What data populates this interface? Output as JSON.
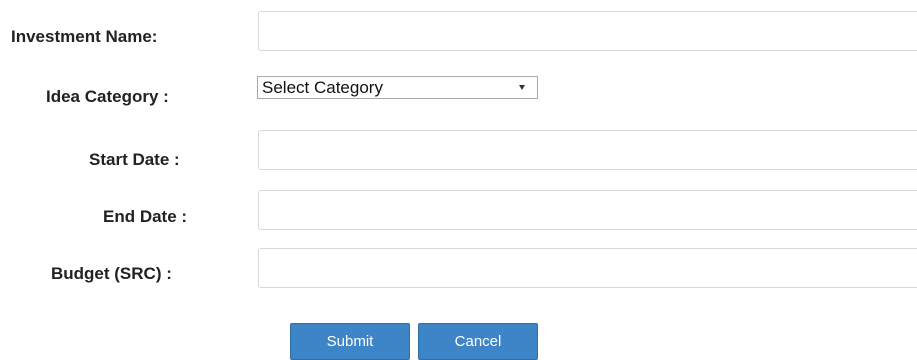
{
  "form": {
    "investment_name": {
      "label": "Investment Name:",
      "value": "",
      "placeholder": ""
    },
    "idea_category": {
      "label": "Idea Category :",
      "selected": "Select Category"
    },
    "start_date": {
      "label": "Start Date :",
      "value": "",
      "placeholder": ""
    },
    "end_date": {
      "label": "End Date :",
      "value": "",
      "placeholder": ""
    },
    "budget": {
      "label": "Budget (SRC) :",
      "value": "",
      "placeholder": ""
    },
    "submit_label": "Submit",
    "cancel_label": "Cancel"
  },
  "colors": {
    "button_bg": "#3d85c6",
    "button_text": "#ffffff",
    "field_border": "#d9d9d9",
    "label_text": "#222222"
  },
  "icons": {
    "select_arrow": "chevron-down-icon"
  }
}
